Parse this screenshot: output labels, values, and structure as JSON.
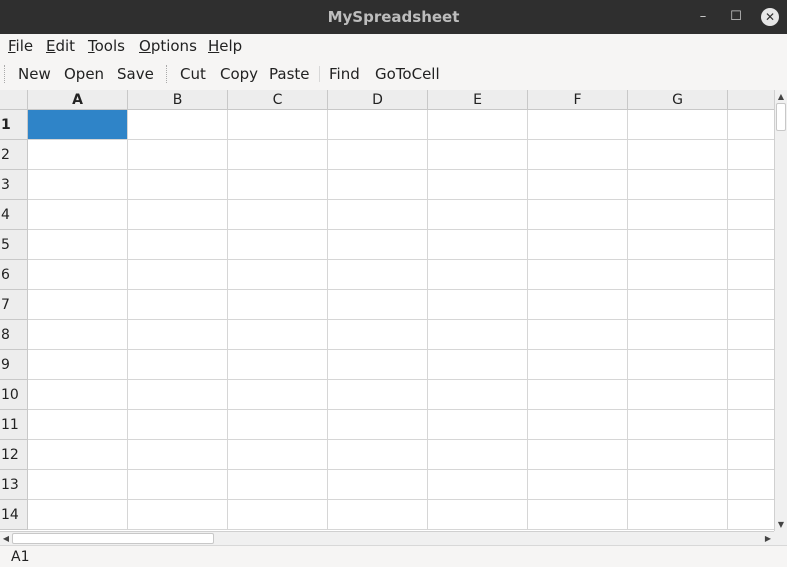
{
  "window": {
    "title": "MySpreadsheet",
    "controls": {
      "minimize": "–",
      "maximize": "☐",
      "close": "✕"
    }
  },
  "menubar": {
    "items": [
      {
        "mnemonic": "F",
        "rest": "ile"
      },
      {
        "mnemonic": "E",
        "rest": "dit"
      },
      {
        "mnemonic": "T",
        "rest": "ools"
      },
      {
        "mnemonic": "O",
        "rest": "ptions"
      },
      {
        "mnemonic": "H",
        "rest": "elp"
      }
    ]
  },
  "toolbar": {
    "file_actions": [
      "New",
      "Open",
      "Save"
    ],
    "edit_actions": [
      "Cut",
      "Copy",
      "Paste"
    ],
    "tool_actions": [
      "Find",
      "GoToCell"
    ]
  },
  "sheet": {
    "columns": [
      "A",
      "B",
      "C",
      "D",
      "E",
      "F",
      "G"
    ],
    "rows": [
      "1",
      "2",
      "3",
      "4",
      "5",
      "6",
      "7",
      "8",
      "9",
      "10",
      "11",
      "12",
      "13",
      "14"
    ],
    "selected_cell": "A1",
    "selection_color": "#2f84c8"
  },
  "scrollbars": {
    "up_arrow": "▲",
    "down_arrow": "▼",
    "left_arrow": "◀",
    "right_arrow": "▶"
  },
  "statusbar": {
    "current_cell": "A1"
  }
}
